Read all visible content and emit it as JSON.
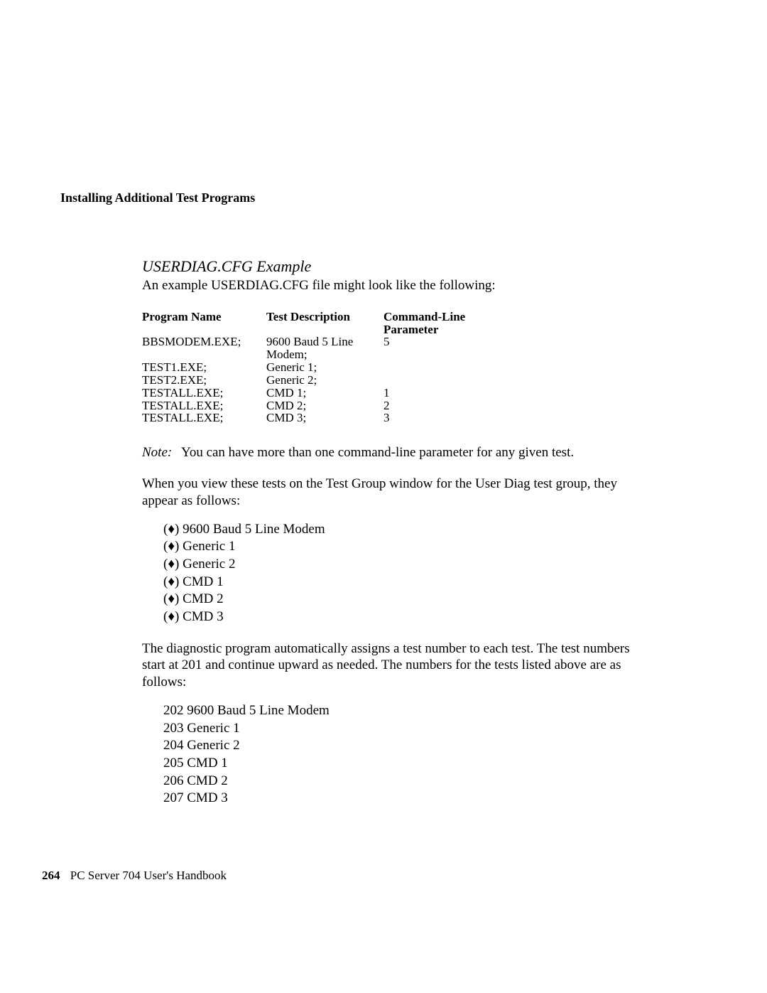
{
  "header": {
    "running_title": "Installing Additional Test Programs"
  },
  "section": {
    "title": "USERDIAG.CFG Example",
    "intro": "An example USERDIAG.CFG file might look like the following:"
  },
  "table": {
    "headers": {
      "prog": "Program Name",
      "desc": "Test Description",
      "param1": "Command-Line",
      "param2": "Parameter"
    },
    "rows": [
      {
        "prog": "BBSMODEM.EXE;",
        "desc": "9600 Baud 5 Line",
        "param": "5"
      },
      {
        "prog": "",
        "desc": "Modem;",
        "param": ""
      },
      {
        "prog": "TEST1.EXE;",
        "desc": "Generic 1;",
        "param": ""
      },
      {
        "prog": "TEST2.EXE;",
        "desc": "Generic 2;",
        "param": ""
      },
      {
        "prog": "TESTALL.EXE;",
        "desc": "CMD 1;",
        "param": "1"
      },
      {
        "prog": "TESTALL.EXE;",
        "desc": "CMD 2;",
        "param": "2"
      },
      {
        "prog": "TESTALL.EXE;",
        "desc": "CMD 3;",
        "param": "3"
      }
    ]
  },
  "note": {
    "label": "Note:",
    "text": "You can have more than one command-line parameter for any given test."
  },
  "para1": "When you view these tests on the Test Group window for the User Diag test group, they appear as follows:",
  "test_list": [
    "9600 Baud 5 Line Modem",
    "Generic 1",
    "Generic 2",
    "CMD 1",
    "CMD 2",
    "CMD 3"
  ],
  "para2": "The diagnostic program automatically assigns a test number to each test.  The test numbers start at 201 and continue upward as needed.  The numbers for the tests listed above are as follows:",
  "num_list": [
    "202 9600 Baud 5 Line Modem",
    "203 Generic 1",
    "204 Generic 2",
    "205 CMD 1",
    "206 CMD 2",
    "207 CMD 3"
  ],
  "footer": {
    "page": "264",
    "book": "PC Server 704 User's Handbook"
  }
}
